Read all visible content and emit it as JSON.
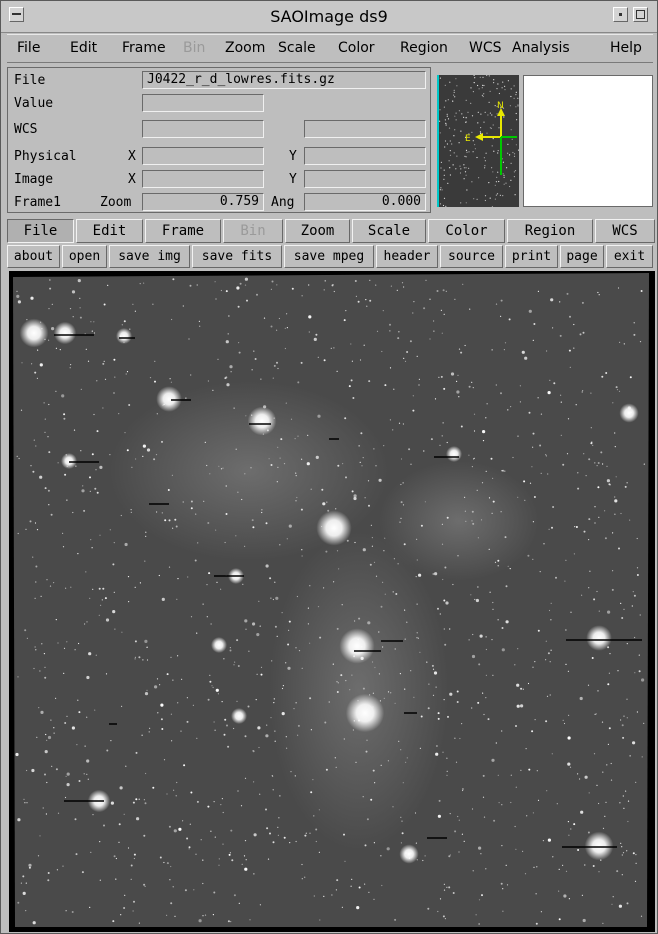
{
  "window": {
    "title": "SAOImage ds9"
  },
  "menubar": {
    "items": [
      "File",
      "Edit",
      "Frame",
      "Bin",
      "Zoom",
      "Scale",
      "Color",
      "Region",
      "WCS",
      "Analysis",
      "Help"
    ],
    "disabled": [
      "Bin"
    ]
  },
  "info": {
    "file_label": "File",
    "file_value": "J0422_r_d_lowres.fits.gz",
    "value_label": "Value",
    "wcs_label": "WCS",
    "physical_label": "Physical",
    "image_label": "Image",
    "frame_label": "Frame1",
    "zoom_label": "Zoom",
    "zoom_value": "0.759",
    "angle_label": "Ang",
    "angle_value": "0.000",
    "x_label": "X",
    "y_label": "Y"
  },
  "panner": {
    "compass": {
      "north": "N",
      "east": "E"
    },
    "accent": "#00c8c8",
    "compass_color": "#e8e800",
    "axis_color": "#00c800"
  },
  "buttonbar": {
    "main": [
      "File",
      "Edit",
      "Frame",
      "Bin",
      "Zoom",
      "Scale",
      "Color",
      "Region",
      "WCS"
    ],
    "main_selected": "File",
    "main_disabled": [
      "Bin"
    ],
    "file_actions": [
      "about",
      "open",
      "save img",
      "save fits",
      "save mpeg",
      "header",
      "source",
      "print",
      "page",
      "exit"
    ]
  },
  "icons": {
    "title_buttons": [
      "menu-icon",
      "minimize-icon",
      "maximize-icon"
    ]
  }
}
